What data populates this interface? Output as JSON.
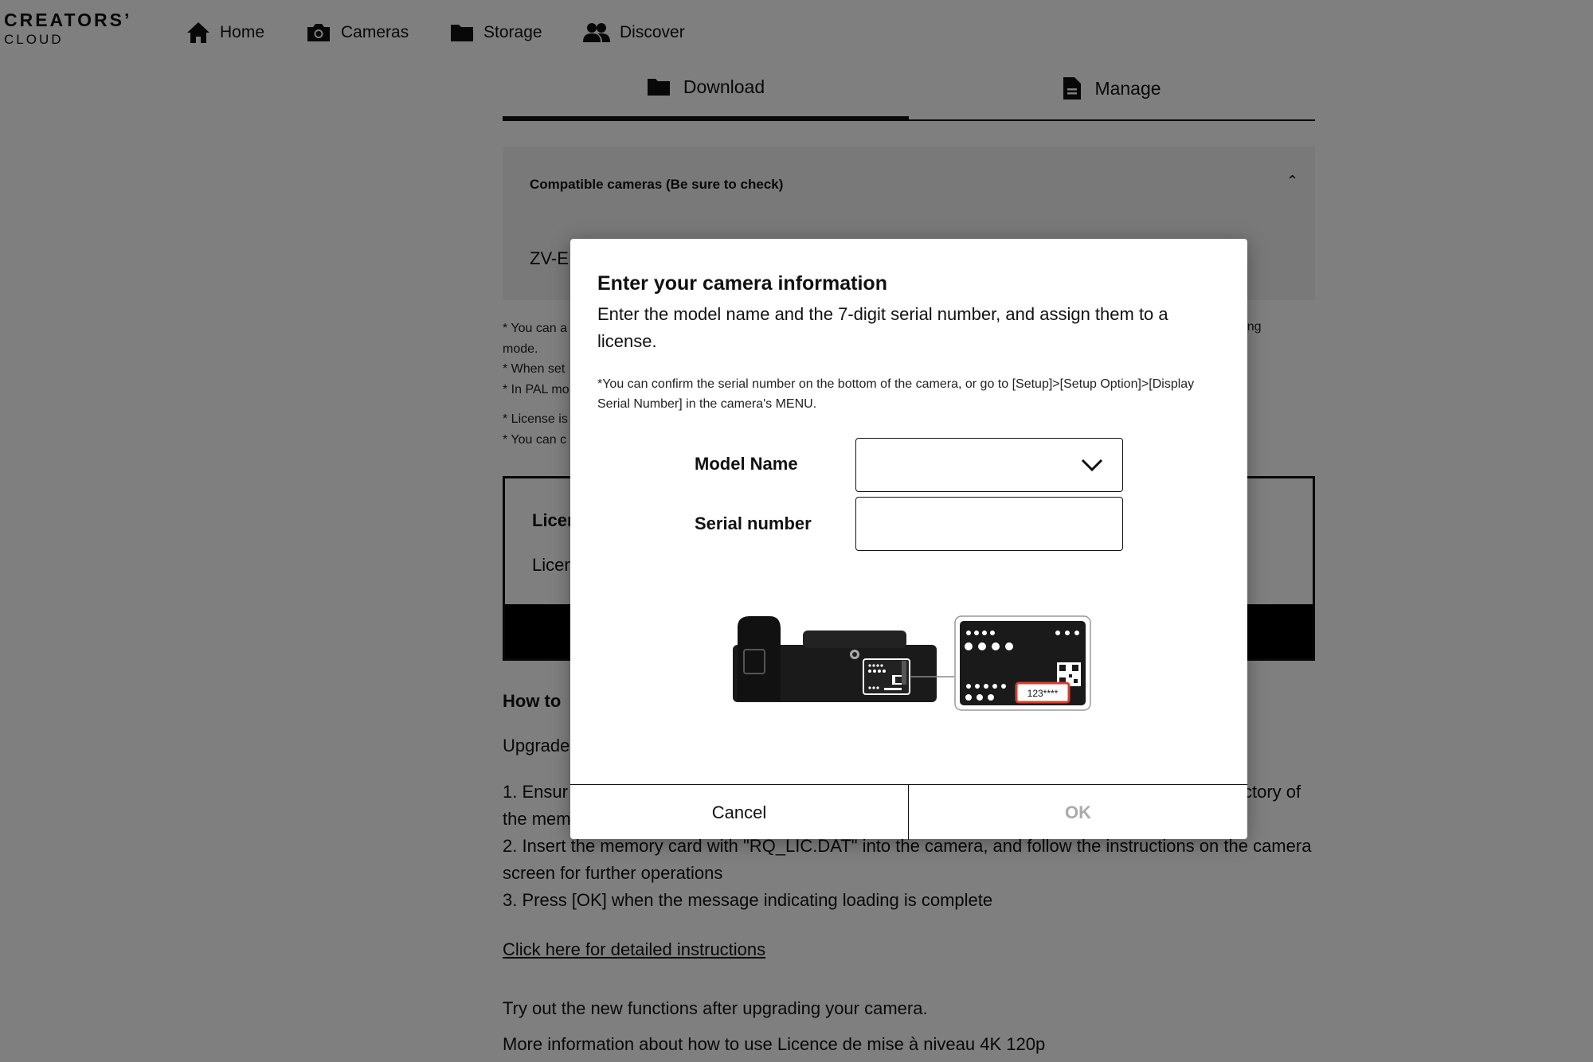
{
  "nav": {
    "logo_top": "CREATORS’",
    "logo_bottom": "CLOUD",
    "items": [
      {
        "label": "Home",
        "icon": "home-icon"
      },
      {
        "label": "Cameras",
        "icon": "camera-icon"
      },
      {
        "label": "Storage",
        "icon": "folder-icon"
      },
      {
        "label": "Discover",
        "icon": "people-icon"
      }
    ]
  },
  "tabs": [
    {
      "label": "Download",
      "icon": "folder-icon",
      "active": true
    },
    {
      "label": "Manage",
      "icon": "document-icon",
      "active": false
    }
  ],
  "compat": {
    "title": "Compatible cameras (Be sure to check)",
    "caret": "⌃",
    "model": "ZV-E"
  },
  "notes": [
    "* You can a",
    "mode.",
    "* When set",
    "* In PAL mo",
    "* License is",
    "* You can c"
  ],
  "notes_end": "rding",
  "license": {
    "title": "Licen",
    "text": "Licen"
  },
  "howto": {
    "title": "How to",
    "intro": "Upgrade",
    "step1_start": "1. Ensur",
    "step1_end": "ctory of",
    "step1_line2": "the mem",
    "step2": "2. Insert the memory card with \"RQ_LIC.DAT\" into the camera, and follow the instructions on the camera screen for further operations",
    "step3": "3. Press [OK] when the message indicating loading is complete",
    "link": "Click here for detailed instructions",
    "tryout": "Try out the new functions after upgrading your camera.",
    "more": "More information about how to use Licence de mise à niveau 4K 120p"
  },
  "modal": {
    "title": "Enter your camera information",
    "description": "Enter the model name and the 7-digit serial number, and assign them to a license.",
    "note": "*You can confirm the serial number on the bottom of the camera, or go to [Setup]>[Setup Option]>[Display Serial Number] in the camera's MENU.",
    "model_label": "Model Name",
    "model_value": "",
    "serial_label": "Serial number",
    "serial_value": "",
    "serial_sample": "123****",
    "cancel_label": "Cancel",
    "ok_label": "OK",
    "ok_disabled_color": "#aaaaaa",
    "serial_highlight_color": "#d9402b"
  }
}
